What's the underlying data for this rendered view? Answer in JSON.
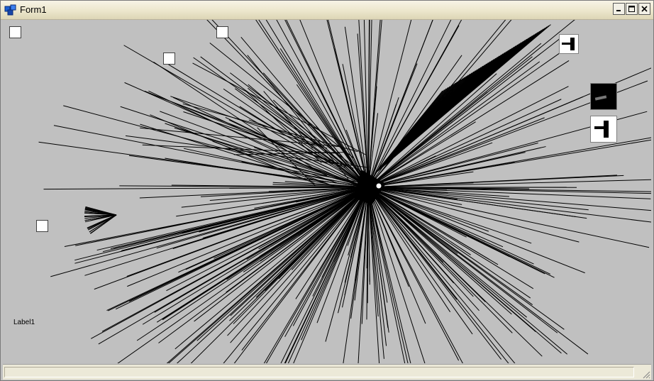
{
  "window": {
    "title": "Form1"
  },
  "label1": {
    "text": "Label1"
  },
  "thumbnails": [
    {
      "name": "thumb-top",
      "background": "#ffffff"
    },
    {
      "name": "thumb-dark",
      "background": "#000000"
    },
    {
      "name": "thumb-bottom",
      "background": "#ffffff"
    }
  ],
  "colors": {
    "form_background": "#c0c0c0",
    "line_color": "#000000",
    "titlebar": "#ece9d8"
  }
}
